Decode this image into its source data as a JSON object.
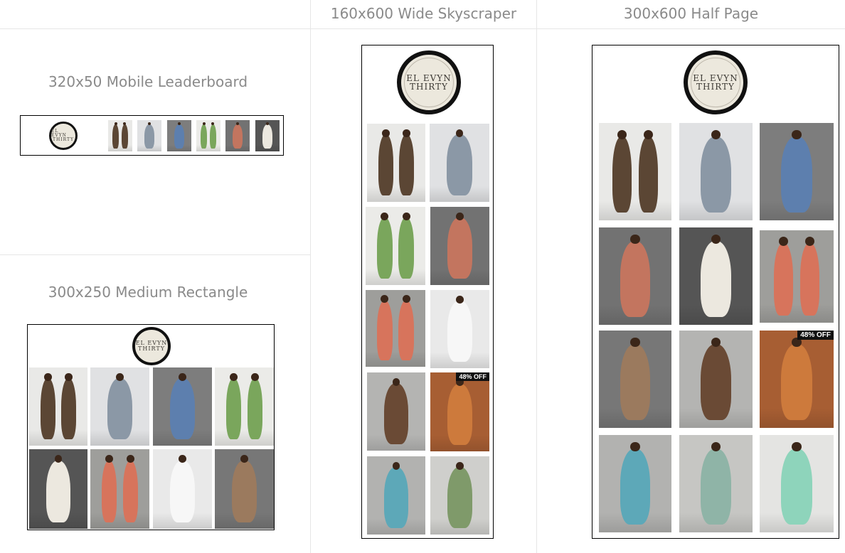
{
  "labels": {
    "leaderboard": "320x50 Mobile Leaderboard",
    "rectangle": "300x250 Medium Rectangle",
    "skyscraper": "160x600 Wide Skyscraper",
    "halfpage": "300x600 Half Page"
  },
  "logo": {
    "line1": "EL EVYN",
    "line2": "THIRTY"
  },
  "badge": {
    "text": "48% OFF"
  },
  "photos": {
    "brown-set": {
      "bg": "#e9e9e7",
      "fig": "#5b4634"
    },
    "snake-print": {
      "bg": "#e0e1e3",
      "fig": "#8b98a6"
    },
    "ripped-jeans": {
      "bg": "#7d7d7d",
      "fig": "#5d7fae"
    },
    "green-print-set": {
      "bg": "#ebebe8",
      "fig": "#7aa65c"
    },
    "stripe-jumpsuit": {
      "bg": "#727272",
      "fig": "#c3755f"
    },
    "white-set-chair": {
      "bg": "#555555",
      "fig": "#ece8df"
    },
    "floral-print-set": {
      "bg": "#9e9e9b",
      "fig": "#d7745c"
    },
    "white-bodysuit": {
      "bg": "#e9e9e9",
      "fig": "#f7f7f7"
    },
    "leopard-dress": {
      "bg": "#777777",
      "fig": "#9b7a5e"
    },
    "brown-leather-dress": {
      "bg": "#b4b4b2",
      "fig": "#6a4a35"
    },
    "orange-sweater": {
      "bg": "#a75e33",
      "fig": "#cd7a3c"
    },
    "blue-print-dress": {
      "bg": "#b2b2b0",
      "fig": "#5da8b8"
    },
    "offshoulder-print-dress": {
      "bg": "#c6c6c3",
      "fig": "#8fb4a7"
    },
    "mint-gown": {
      "bg": "#e4e4e2",
      "fig": "#8ed4bb"
    },
    "plant-dress": {
      "bg": "#cfcfcc",
      "fig": "#7f9a6a"
    }
  }
}
